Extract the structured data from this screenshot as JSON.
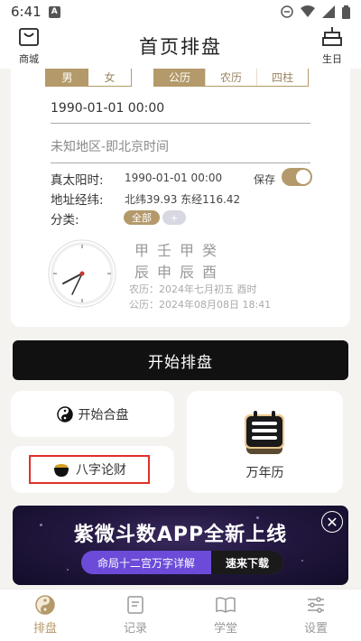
{
  "status_bar": {
    "time": "6:41",
    "notification_badge": "A"
  },
  "top_nav": {
    "shop_label": "商城",
    "title": "首页排盘",
    "birthday_label": "生日"
  },
  "gender_options": [
    {
      "label": "男",
      "active": true
    },
    {
      "label": "女",
      "active": false
    }
  ],
  "calendar_options": [
    {
      "label": "公历",
      "active": true
    },
    {
      "label": "农历",
      "active": false
    },
    {
      "label": "四柱",
      "active": false
    }
  ],
  "birth_datetime": "1990-01-01 00:00",
  "location": "未知地区-即北京时间",
  "true_solar_time": {
    "label": "真太阳时:",
    "value": "1990-01-01 00:00"
  },
  "save_toggle": {
    "label": "保存",
    "on": true
  },
  "coordinates": {
    "label": "地址经纬:",
    "value": "北纬39.93 东经116.42"
  },
  "category": {
    "label": "分类:",
    "chips": [
      "全部",
      "+"
    ]
  },
  "bazi_rows": [
    "甲壬甲癸",
    "辰申辰酉"
  ],
  "lunar_date": "农历：2024年七月初五 酉时",
  "solar_date": "公历：2024年08月08日 18:41",
  "start_button": "开始排盘",
  "tiles": {
    "hehun": "开始合盘",
    "bazi_wealth": "八字论财",
    "wannianli": "万年历"
  },
  "banner": {
    "headline": "紫微斗数APP全新上线",
    "subline": "命局十二宫万字详解",
    "cta": "速来下载"
  },
  "tab_bar": [
    {
      "label": "排盘",
      "active": true,
      "icon": "yin-yang-icon"
    },
    {
      "label": "记录",
      "active": false,
      "icon": "record-icon"
    },
    {
      "label": "学堂",
      "active": false,
      "icon": "book-icon"
    },
    {
      "label": "设置",
      "active": false,
      "icon": "settings-sliders-icon"
    }
  ],
  "colors": {
    "accent": "#b49a6a",
    "highlight_box": "#e0302a",
    "primary_button": "#111111"
  }
}
